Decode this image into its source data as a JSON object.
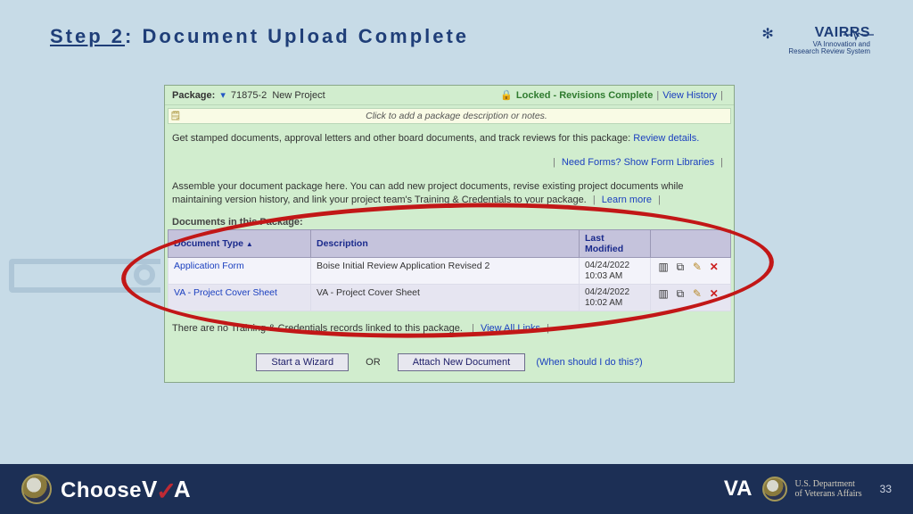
{
  "header": {
    "step_label": "Step 2",
    "title_rest": ": Document Upload Complete",
    "brand_name": "VAIRRS",
    "brand_sub1": "VA Innovation and",
    "brand_sub2": "Research Review System"
  },
  "panel": {
    "package_label": "Package:",
    "package_id": "71875-2",
    "package_name": "New Project",
    "locked_text": "Locked - Revisions Complete",
    "view_history": "View History",
    "note_placeholder": "Click to add a package description or notes.",
    "stamped_text": "Get stamped documents, approval letters and other board documents, and track reviews for this package:",
    "review_details": "Review details.",
    "need_forms": "Need Forms? Show Form Libraries",
    "assemble_text": "Assemble your document package here. You can add new project documents, revise existing project documents while maintaining version history, and link your project team's Training & Credentials to your package.",
    "learn_more": "Learn more",
    "docs_in_pkg": "Documents in this Package:",
    "table": {
      "th_type": "Document Type",
      "th_desc": "Description",
      "th_mod": "Last Modified",
      "rows": [
        {
          "type": "Application Form",
          "desc": "Boise Initial Review Application Revised 2",
          "date": "04/24/2022",
          "time": "10:03 AM"
        },
        {
          "type": "VA - Project Cover Sheet",
          "desc": "VA - Project Cover Sheet",
          "date": "04/24/2022",
          "time": "10:02 AM"
        }
      ]
    },
    "no_training": "There are no Training & Credentials records linked to this package.",
    "view_all_links": "View All Links",
    "start_wizard": "Start a Wizard",
    "or": "OR",
    "attach_new": "Attach New Document",
    "when_should": "(When should I do this?)"
  },
  "footer": {
    "choose": "Choose",
    "v": "V",
    "a": "A",
    "va_mark": "VA",
    "dept1": "U.S. Department",
    "dept2": "of Veterans Affairs",
    "page": "33"
  }
}
